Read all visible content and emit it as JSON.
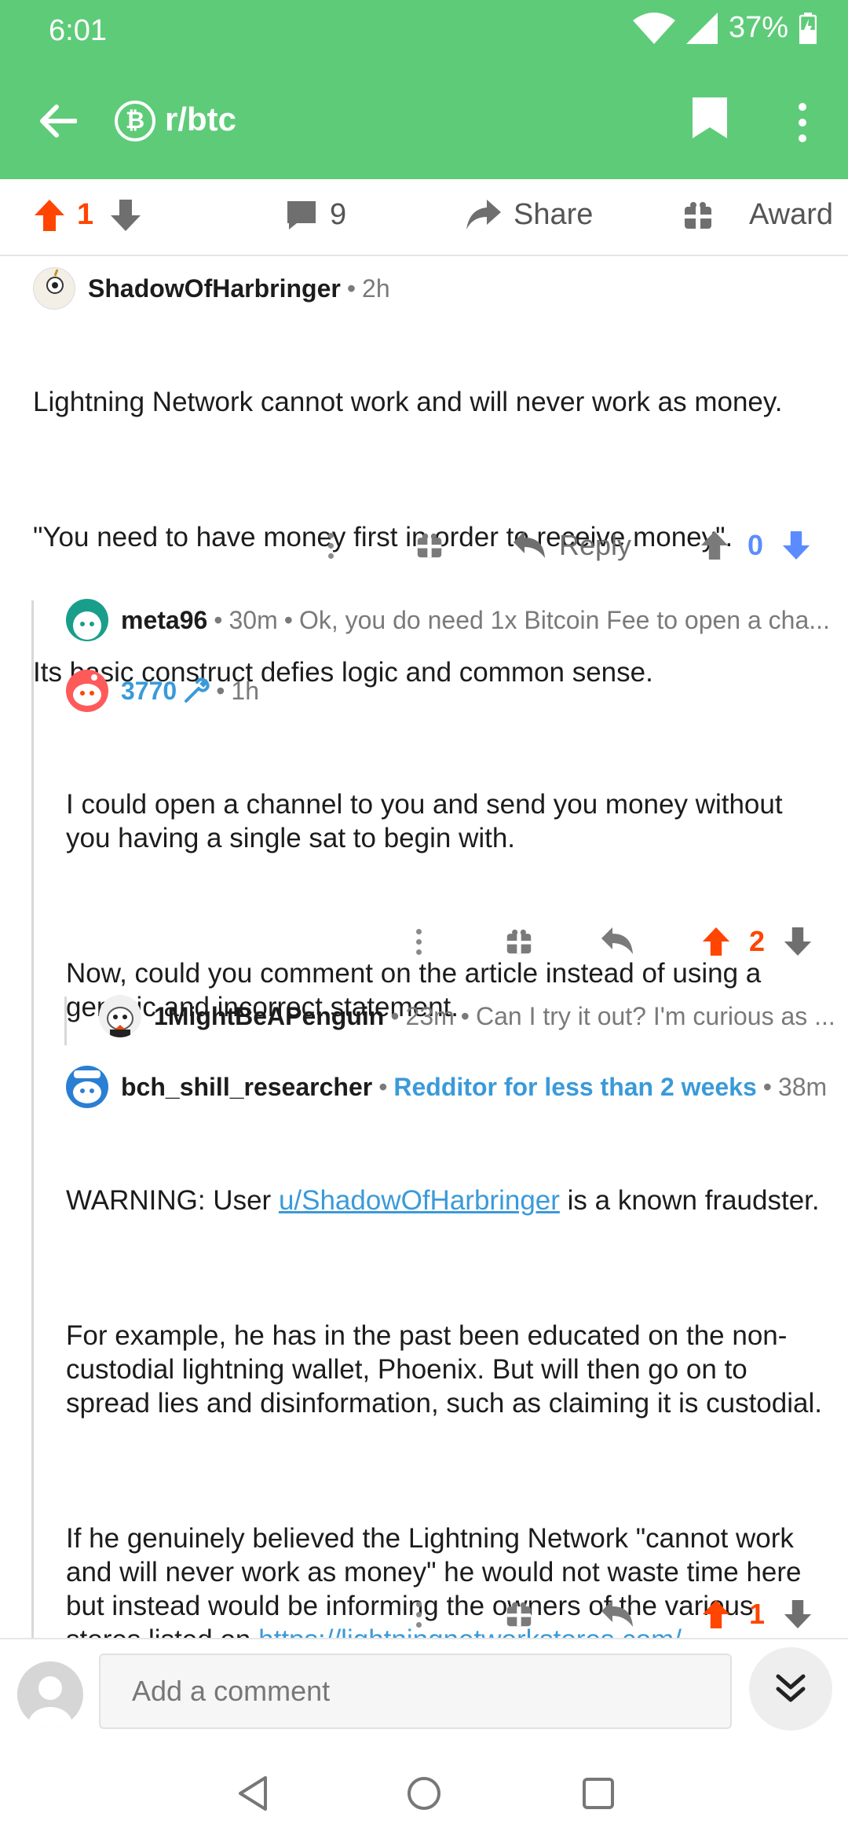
{
  "status_bar": {
    "time": "6:01",
    "battery": "37%"
  },
  "app_bar": {
    "subreddit": "r/btc",
    "sub_logo_glyph": "₿"
  },
  "post_actions": {
    "score": "1",
    "comments": "9",
    "share_label": "Share",
    "award_label": "Award"
  },
  "comments": [
    {
      "user": "ShadowOfHarbringer",
      "time": "2h",
      "paragraphs": [
        "Lightning Network cannot work and will never work as money.",
        "\"You need to have money first in order to receive money\".",
        "Its basic construct defies logic and common sense."
      ],
      "reply_label": "Reply",
      "score": "0"
    },
    {
      "user": "meta96",
      "time": "30m",
      "preview": "Ok, you do need 1x Bitcoin Fee to open a cha..."
    },
    {
      "user": "3770",
      "time": "1h",
      "paragraphs": [
        "I could open a channel to you and send you money without you having a single sat to begin with.",
        "Now, could you comment on the article instead of using a generic and incorrect statement."
      ],
      "score": "2"
    },
    {
      "user": "1MightBeAPenguin",
      "time": "23m",
      "preview": "Can I try it out? I'm curious as ..."
    },
    {
      "user": "bch_shill_researcher",
      "flair": "Redditor for less than 2 weeks",
      "time": "38m",
      "p1_before": "WARNING: User ",
      "p1_link": "u/ShadowOfHarbringer",
      "p1_after": " is a known fraudster.",
      "p2": "For example, he has in the past been educated on the non-custodial lightning wallet, Phoenix. But will then go on to spread lies and disinformation, such as claiming it is custodial.",
      "p3_before": "If he genuinely believed the Lightning Network \"cannot work and will never work as money\" he would not waste time here but instead would be informing the owners of the various stores listed on ",
      "p3_link": "https://lightningnetworkstores.com/",
      "p3_after": ".",
      "score": "1"
    }
  ],
  "comment_bar": {
    "placeholder": "Add a comment"
  },
  "colors": {
    "header": "#5ecb79",
    "upvote": "#ff4500",
    "downvote_active": "#5b8cff",
    "link": "#3a9ad9"
  }
}
